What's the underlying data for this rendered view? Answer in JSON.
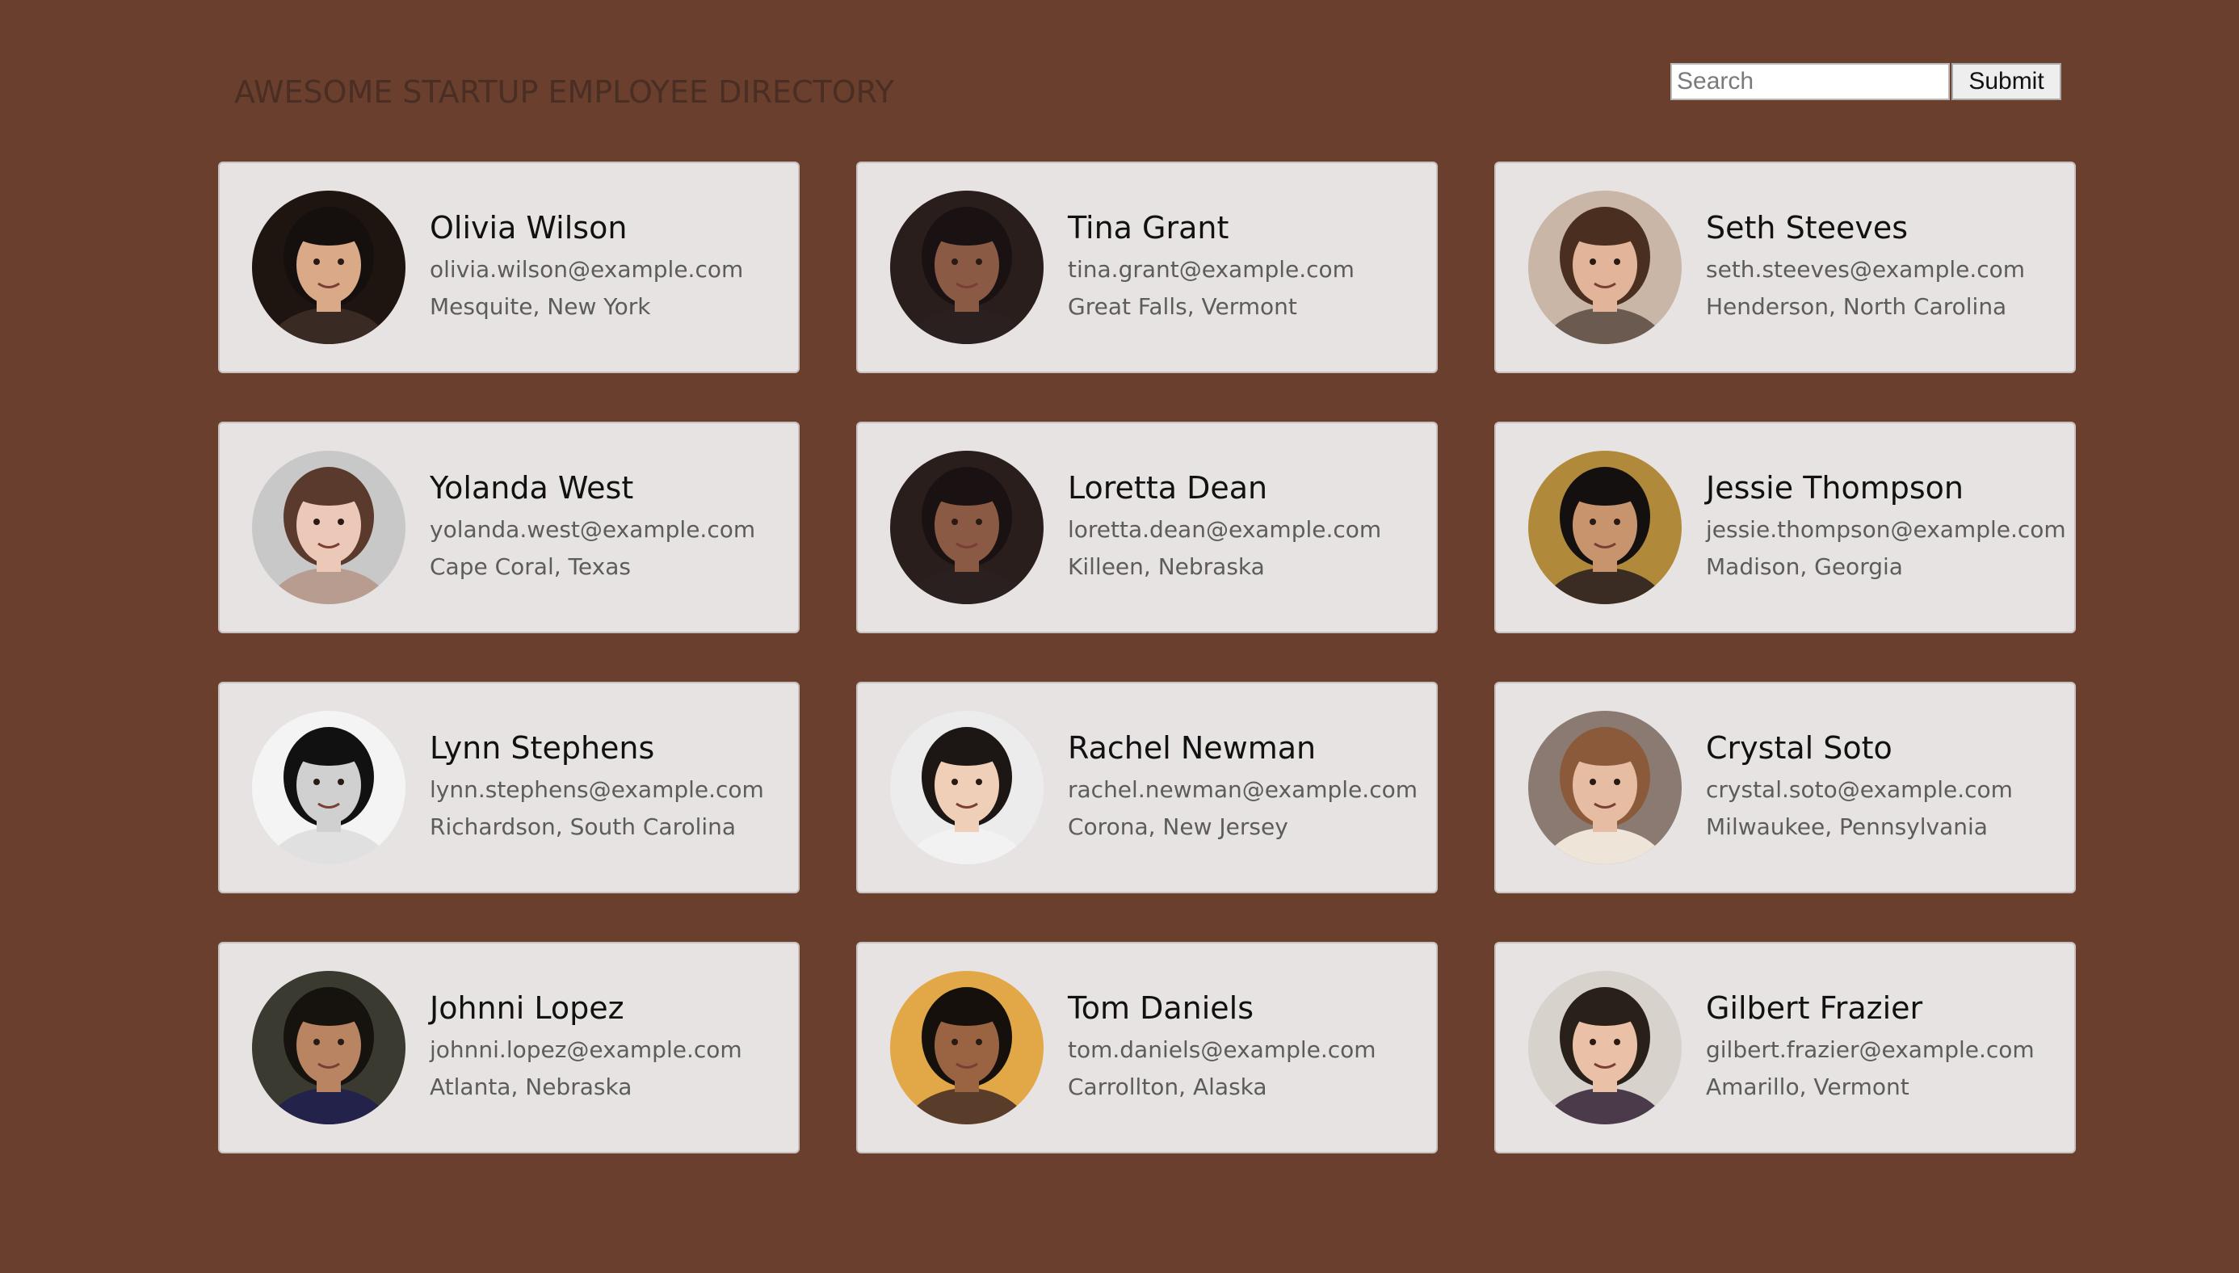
{
  "header": {
    "title": "AWESOME STARTUP EMPLOYEE DIRECTORY"
  },
  "search": {
    "placeholder": "Search",
    "value": "",
    "submit_label": "Submit"
  },
  "employees": [
    {
      "name": "Olivia Wilson",
      "email": "olivia.wilson@example.com",
      "location": "Mesquite, New York",
      "avatar_colors": {
        "bg": "#1e1410",
        "skin": "#d9a988",
        "hair": "#15100d",
        "cloth": "#3a2a24"
      }
    },
    {
      "name": "Tina Grant",
      "email": "tina.grant@example.com",
      "location": "Great Falls, Vermont",
      "avatar_colors": {
        "bg": "#2a1e1c",
        "skin": "#8a5a45",
        "hair": "#1a1212",
        "cloth": "#2a2020"
      }
    },
    {
      "name": "Seth Steeves",
      "email": "seth.steeves@example.com",
      "location": "Henderson, North Carolina",
      "avatar_colors": {
        "bg": "#c9b6a6",
        "skin": "#e2b49a",
        "hair": "#4a2e20",
        "cloth": "#6a5a50"
      }
    },
    {
      "name": "Yolanda West",
      "email": "yolanda.west@example.com",
      "location": "Cape Coral, Texas",
      "avatar_colors": {
        "bg": "#c8c8c8",
        "skin": "#ecc8b8",
        "hair": "#5a3a2c",
        "cloth": "#b89c90"
      }
    },
    {
      "name": "Loretta Dean",
      "email": "loretta.dean@example.com",
      "location": "Killeen, Nebraska",
      "avatar_colors": {
        "bg": "#2a1e1c",
        "skin": "#8a5a45",
        "hair": "#1a1212",
        "cloth": "#2a2020"
      }
    },
    {
      "name": "Jessie Thompson",
      "email": "jessie.thompson@example.com",
      "location": "Madison, Georgia",
      "avatar_colors": {
        "bg": "#b08a3a",
        "skin": "#c8946e",
        "hair": "#141010",
        "cloth": "#3a2c22"
      }
    },
    {
      "name": "Lynn Stephens",
      "email": "lynn.stephens@example.com",
      "location": "Richardson, South Carolina",
      "avatar_colors": {
        "bg": "#f4f4f4",
        "skin": "#d0d0d0",
        "hair": "#111111",
        "cloth": "#e0e0e0"
      }
    },
    {
      "name": "Rachel Newman",
      "email": "rachel.newman@example.com",
      "location": "Corona, New Jersey",
      "avatar_colors": {
        "bg": "#ececec",
        "skin": "#efcfb8",
        "hair": "#1c1614",
        "cloth": "#f2f2f2"
      }
    },
    {
      "name": "Crystal Soto",
      "email": "crystal.soto@example.com",
      "location": "Milwaukee, Pennsylvania",
      "avatar_colors": {
        "bg": "#8a7a72",
        "skin": "#e6bca2",
        "hair": "#8a5a3a",
        "cloth": "#efe4d8"
      }
    },
    {
      "name": "Johnni Lopez",
      "email": "johnni.lopez@example.com",
      "location": "Atlanta, Nebraska",
      "avatar_colors": {
        "bg": "#3a3a30",
        "skin": "#b98462",
        "hair": "#16120e",
        "cloth": "#22224a"
      }
    },
    {
      "name": "Tom Daniels",
      "email": "tom.daniels@example.com",
      "location": "Carrollton, Alaska",
      "avatar_colors": {
        "bg": "#e2a848",
        "skin": "#9a6442",
        "hair": "#15100c",
        "cloth": "#5a3c2a"
      }
    },
    {
      "name": "Gilbert Frazier",
      "email": "gilbert.frazier@example.com",
      "location": "Amarillo, Vermont",
      "avatar_colors": {
        "bg": "#d8d2cc",
        "skin": "#eac0a6",
        "hair": "#2a201a",
        "cloth": "#4a3a4a"
      }
    }
  ]
}
